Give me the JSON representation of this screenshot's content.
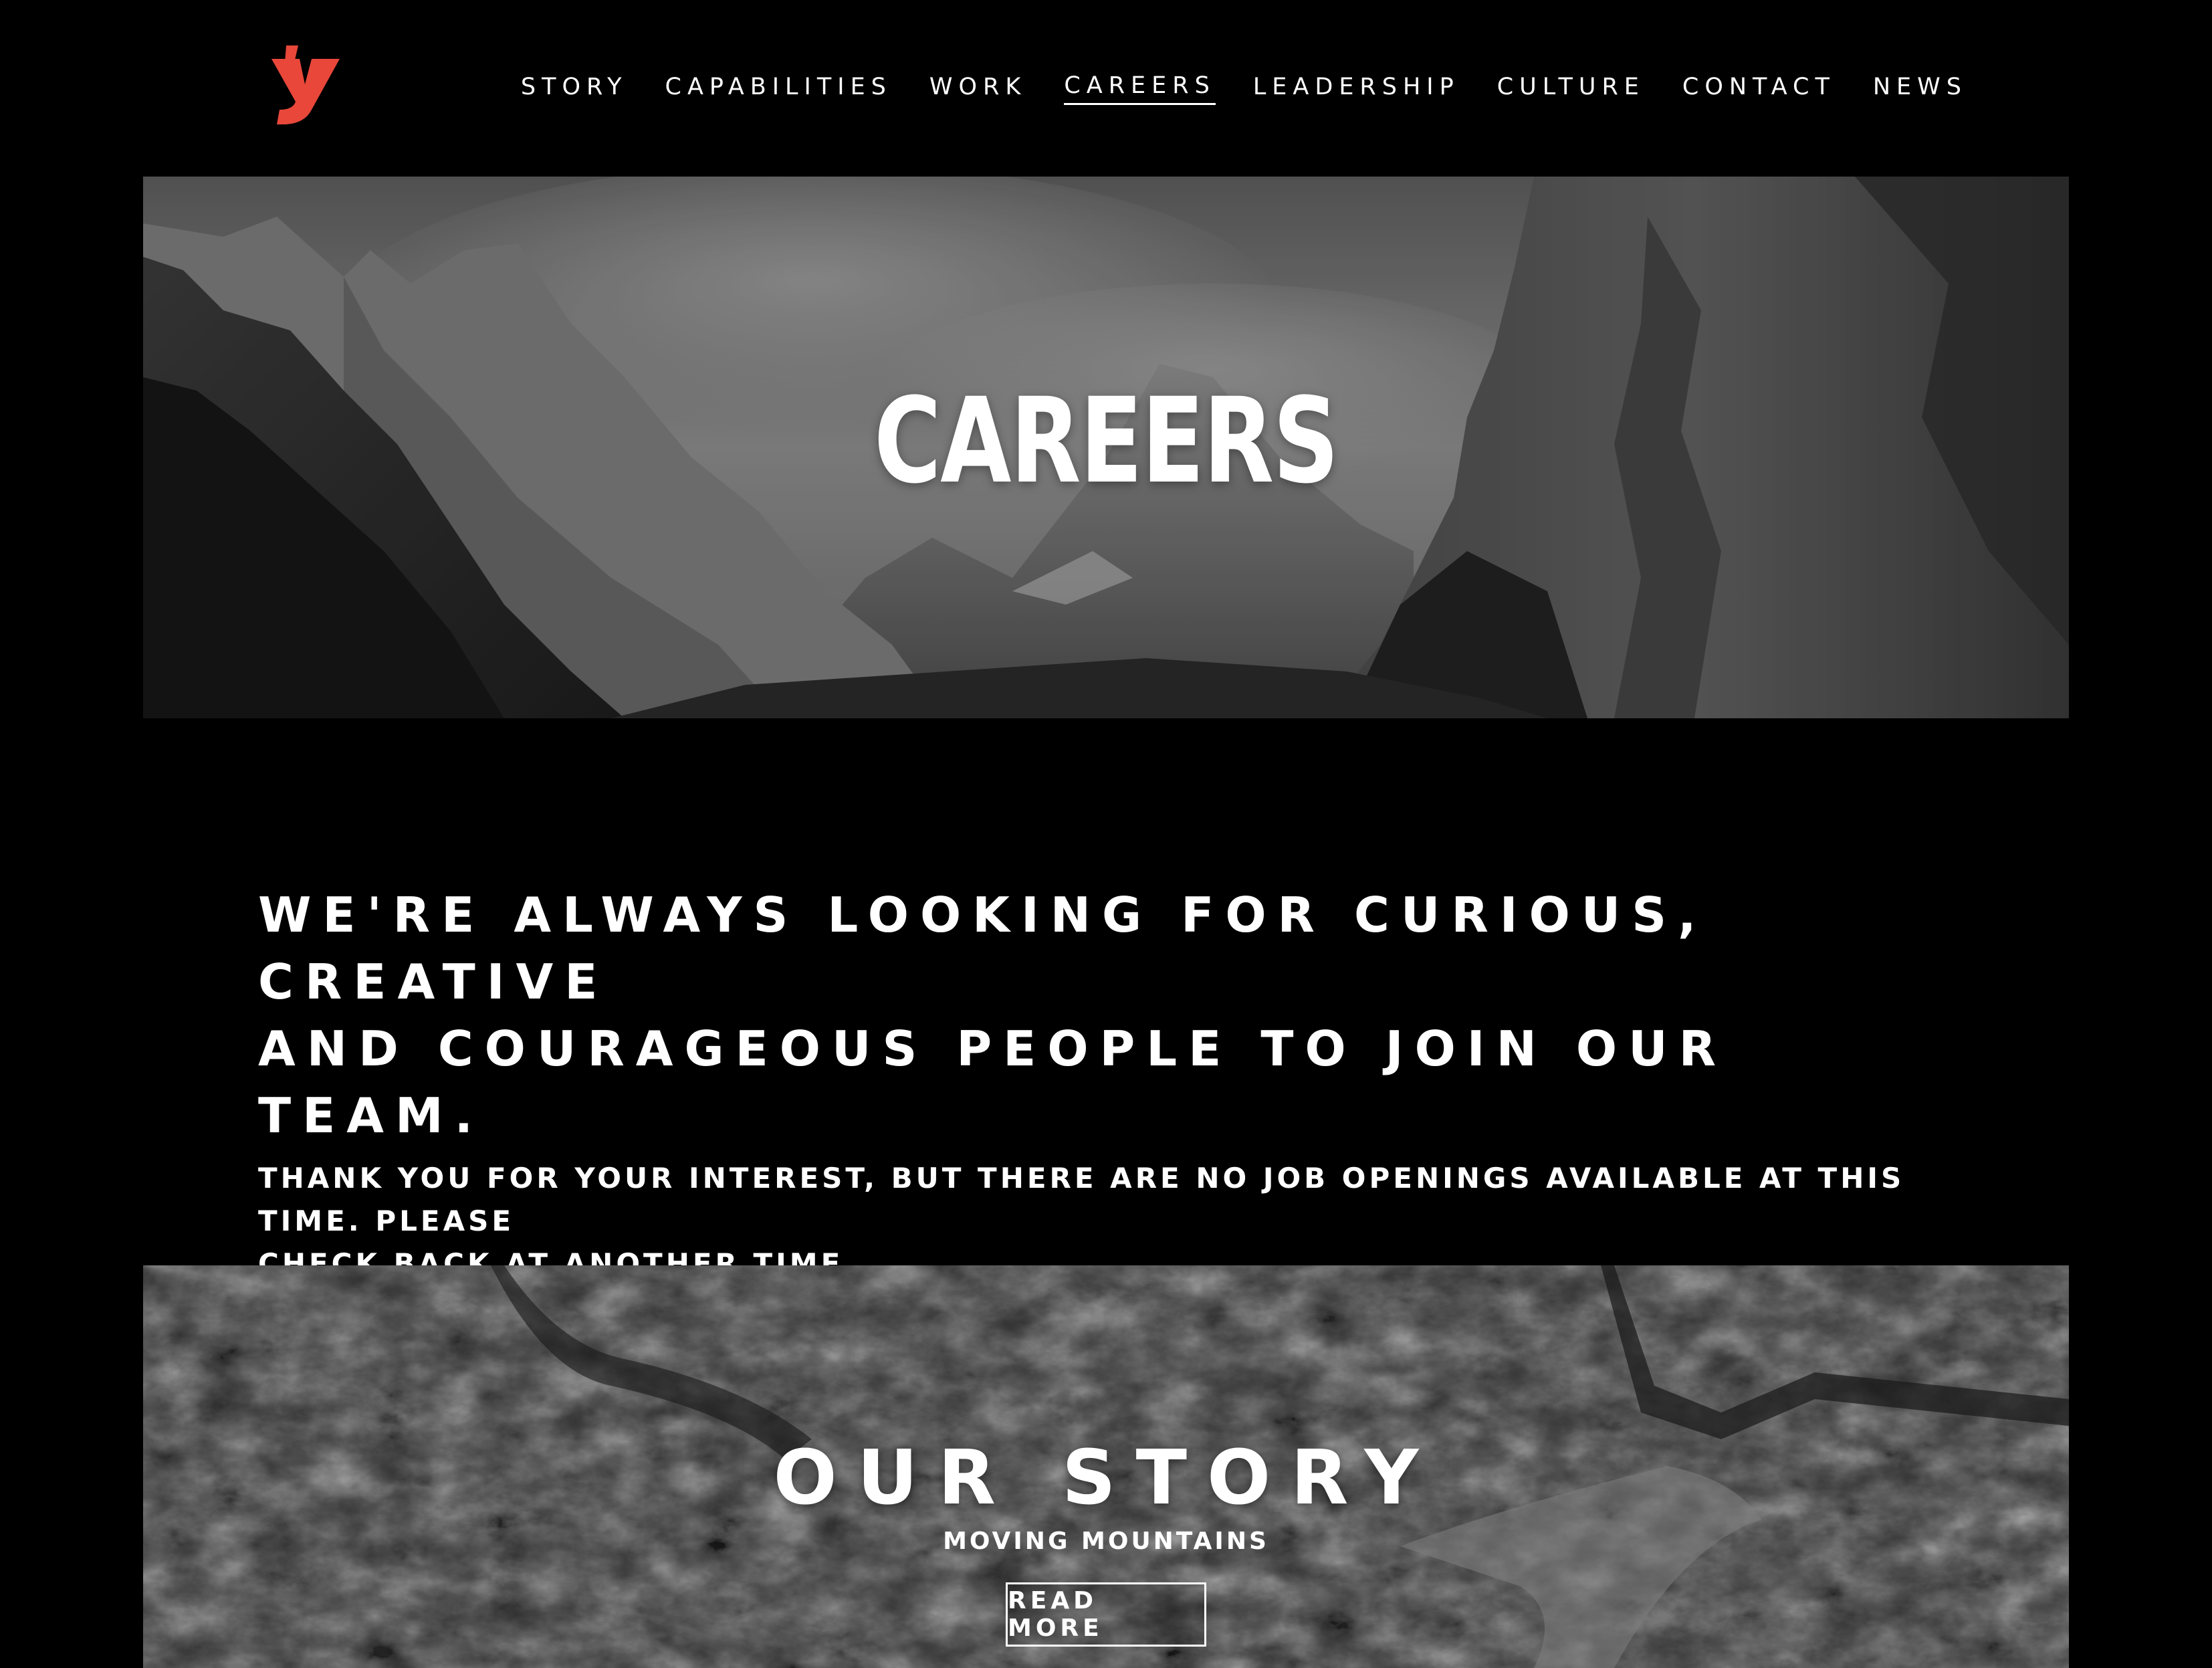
{
  "header": {
    "logo_label": "y",
    "logo_color": "#e8473a",
    "nav": [
      {
        "label": "STORY",
        "active": false
      },
      {
        "label": "CAPABILITIES",
        "active": false
      },
      {
        "label": "WORK",
        "active": false
      },
      {
        "label": "CAREERS",
        "active": true
      },
      {
        "label": "LEADERSHIP",
        "active": false
      },
      {
        "label": "CULTURE",
        "active": false
      },
      {
        "label": "CONTACT",
        "active": false
      },
      {
        "label": "NEWS",
        "active": false
      }
    ]
  },
  "hero": {
    "title": "CAREERS",
    "image": "mountain-valley-photo"
  },
  "intro": {
    "heading": "WE'RE ALWAYS LOOKING FOR CURIOUS, CREATIVE\nAND COURAGEOUS PEOPLE TO JOIN OUR TEAM.",
    "body": "THANK YOU FOR YOUR INTEREST, BUT THERE ARE NO JOB OPENINGS AVAILABLE AT THIS TIME. PLEASE\nCHECK BACK AT ANOTHER TIME."
  },
  "story": {
    "title": "OUR STORY",
    "subtitle": "MOVING MOUNTAINS",
    "button_label": "READ MORE",
    "image": "rock-texture-photo"
  },
  "colors": {
    "background": "#000000",
    "text": "#ffffff",
    "accent": "#e8473a"
  }
}
